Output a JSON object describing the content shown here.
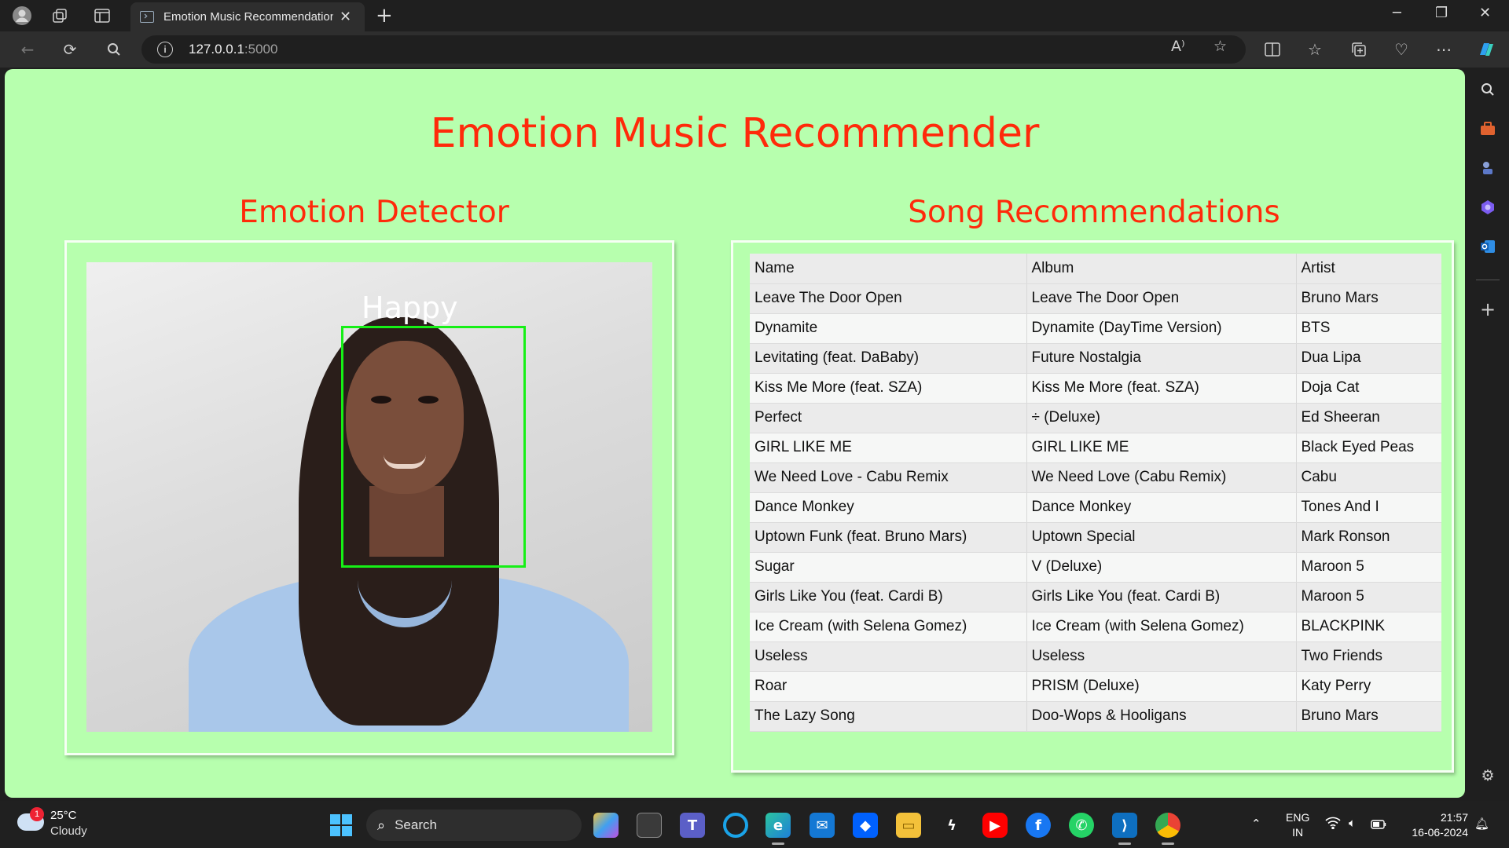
{
  "browser": {
    "tab_title": "Emotion Music Recommendation",
    "tab_close": "✕",
    "new_tab": "+",
    "url_host": "127.0.0.1",
    "url_port": ":5000",
    "info": "i"
  },
  "page": {
    "title": "Emotion Music Recommender",
    "detector_heading": "Emotion Detector",
    "detected_emotion": "Happy",
    "songs_heading": "Song Recommendations",
    "table": {
      "headers": [
        "Name",
        "Album",
        "Artist"
      ],
      "rows": [
        [
          "Leave The Door Open",
          "Leave The Door Open",
          "Bruno Mars"
        ],
        [
          "Dynamite",
          "Dynamite (DayTime Version)",
          "BTS"
        ],
        [
          "Levitating (feat. DaBaby)",
          "Future Nostalgia",
          "Dua Lipa"
        ],
        [
          "Kiss Me More (feat. SZA)",
          "Kiss Me More (feat. SZA)",
          "Doja Cat"
        ],
        [
          "Perfect",
          "÷ (Deluxe)",
          "Ed Sheeran"
        ],
        [
          "GIRL LIKE ME",
          "GIRL LIKE ME",
          "Black Eyed Peas"
        ],
        [
          "We Need Love - Cabu Remix",
          "We Need Love (Cabu Remix)",
          "Cabu"
        ],
        [
          "Dance Monkey",
          "Dance Monkey",
          "Tones And I"
        ],
        [
          "Uptown Funk (feat. Bruno Mars)",
          "Uptown Special",
          "Mark Ronson"
        ],
        [
          "Sugar",
          "V (Deluxe)",
          "Maroon 5"
        ],
        [
          "Girls Like You (feat. Cardi B)",
          "Girls Like You (feat. Cardi B)",
          "Maroon 5"
        ],
        [
          "Ice Cream (with Selena Gomez)",
          "Ice Cream (with Selena Gomez)",
          "BLACKPINK"
        ],
        [
          "Useless",
          "Useless",
          "Two Friends"
        ],
        [
          "Roar",
          "PRISM (Deluxe)",
          "Katy Perry"
        ],
        [
          "The Lazy Song",
          "Doo-Wops & Hooligans",
          "Bruno Mars"
        ]
      ]
    }
  },
  "taskbar": {
    "weather_badge": "1",
    "weather_temp": "25°C",
    "weather_desc": "Cloudy",
    "search_label": "Search",
    "lang_line1": "ENG",
    "lang_line2": "IN",
    "time": "21:57",
    "date": "16-06-2024"
  },
  "colors": {
    "page_bg": "#b7ffae",
    "heading": "#ff2a0a",
    "face_box": "#16f016"
  }
}
